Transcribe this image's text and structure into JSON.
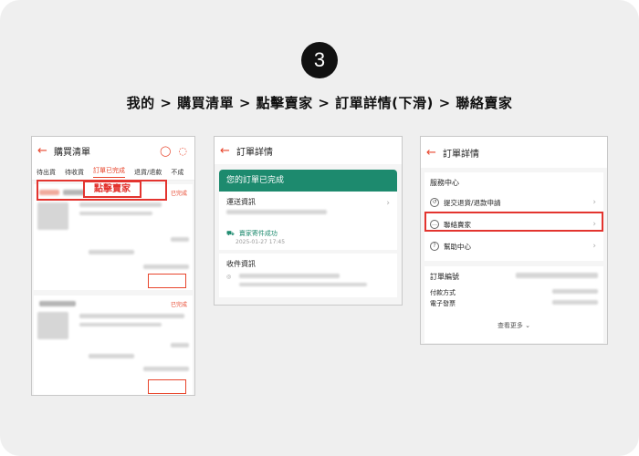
{
  "step": "3",
  "breadcrumb": "我的 > 購買清單 > 點擊賣家 > 訂單詳情(下滑) > 聯絡賣家",
  "screen1": {
    "title": "購買清單",
    "icons": [
      "back-arrow-icon",
      "search-icon",
      "chat-icon"
    ],
    "tabs": [
      "待出貨",
      "待收貨",
      "訂單已完成",
      "退貨/退款",
      "不成"
    ],
    "active_tab": "訂單已完成",
    "callout": "點擊賣家",
    "status_label_1": "已完成",
    "status_label_2": "已完成"
  },
  "screen2": {
    "title": "訂單詳情",
    "banner": "您的訂單已完成",
    "shipping_title": "運送資訊",
    "delivery_status": "賣家寄件成功",
    "delivery_time": "2025-01-27 17:45",
    "receiver_title": "收件資訊"
  },
  "screen3": {
    "title": "訂單詳情",
    "service_title": "服務中心",
    "items": [
      {
        "icon": "return-icon",
        "label": "提交退貨/退款申請"
      },
      {
        "icon": "chat-icon",
        "label": "聯絡賣家"
      },
      {
        "icon": "help-icon",
        "label": "幫助中心"
      }
    ],
    "order_no_label": "訂單編號",
    "payment_label": "付款方式",
    "invoice_label": "電子發票",
    "see_more": "查看更多"
  },
  "colors": {
    "accent": "#e8452c",
    "highlight": "#e3342f",
    "green": "#1d8a6e"
  }
}
